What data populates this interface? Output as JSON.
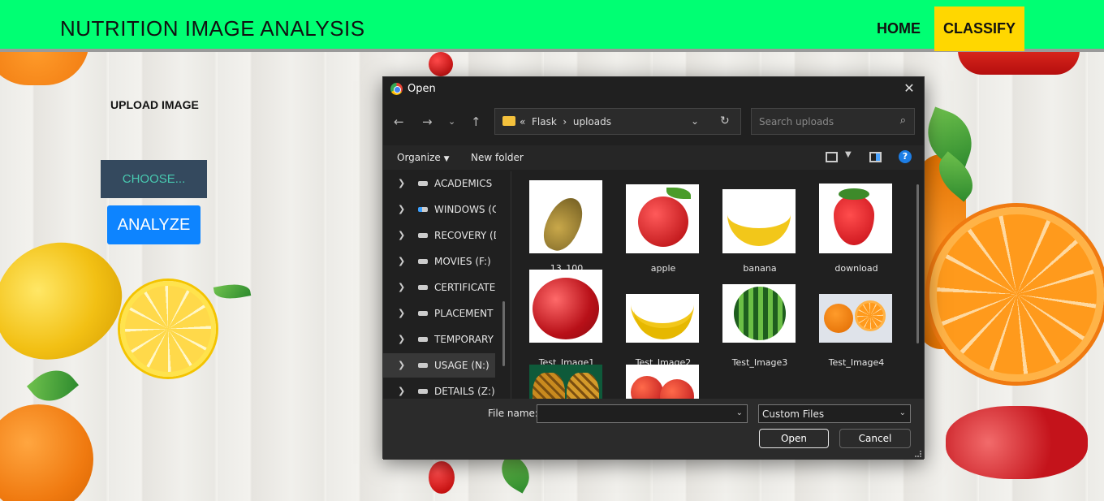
{
  "header": {
    "brand": "NUTRITION IMAGE ANALYSIS",
    "nav": {
      "home": "HOME",
      "classify": "CLASSIFY"
    },
    "colors": {
      "bar": "#00ff73",
      "active_nav": "#ffd700"
    }
  },
  "upload": {
    "label": "UPLOAD IMAGE",
    "choose_button": "CHOOSE...",
    "analyze_button": "ANALYZE"
  },
  "dialog": {
    "title": "Open",
    "close_icon": "close-icon",
    "nav_icons": [
      "back-arrow-icon",
      "forward-arrow-icon",
      "recent-dropdown-icon",
      "up-arrow-icon"
    ],
    "address": {
      "prefix": "«",
      "path": [
        "Flask",
        "uploads"
      ]
    },
    "search_placeholder": "Search uploads",
    "toolbar": {
      "organize": "Organize",
      "new_folder": "New folder"
    },
    "drives": [
      {
        "label": "ACADEMICS (E"
      },
      {
        "label": "WINDOWS (C:)"
      },
      {
        "label": "RECOVERY (D:)"
      },
      {
        "label": "MOVIES (F:)"
      },
      {
        "label": "CERTIFICATE (G"
      },
      {
        "label": "PLACEMENT (I"
      },
      {
        "label": "TEMPORARY ("
      },
      {
        "label": "USAGE (N:)",
        "selected": true
      },
      {
        "label": "DETAILS (Z:)"
      }
    ],
    "files": [
      {
        "name": "13_100",
        "icon": "pear-image"
      },
      {
        "name": "apple",
        "icon": "apple-image"
      },
      {
        "name": "banana",
        "icon": "banana-image"
      },
      {
        "name": "download",
        "icon": "strawberry-image"
      },
      {
        "name": "Test_Image1",
        "icon": "apple-image"
      },
      {
        "name": "Test_Image2",
        "icon": "banana-bunch-image"
      },
      {
        "name": "Test_Image3",
        "icon": "watermelon-image"
      },
      {
        "name": "Test_Image4",
        "icon": "orange-image"
      },
      {
        "name": "",
        "icon": "pineapple-image"
      },
      {
        "name": "",
        "icon": "apples-image"
      }
    ],
    "footer": {
      "file_name_label": "File name:",
      "file_name_value": "",
      "file_type": "Custom Files",
      "open_button": "Open",
      "cancel_button": "Cancel"
    }
  }
}
